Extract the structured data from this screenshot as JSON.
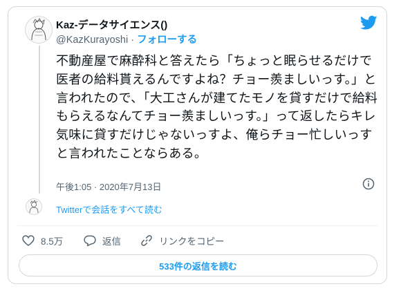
{
  "tweet": {
    "display_name": "Kaz-データサイエンス()",
    "handle": "@KazKurayoshi",
    "separator": " · ",
    "follow_label": "フォローする",
    "text": "不動産屋で麻酔科と答えたら「ちょっと眠らせるだけで医者の給料貰えるんですよね？チョー羨ましいっす。」と言われたので、「大工さんが建てたモノを貸すだけで給料もらえるなんてチョー羨ましいっす。」って返したらキレ気味に貸すだけじゃないっすよ、俺らチョー忙しいっすと言われたことならある。",
    "timestamp": "午後1:05 · 2020年7月13日",
    "thread_link": "Twitterで会話をすべて読む"
  },
  "actions": {
    "likes": "8.5万",
    "reply_label": "返信",
    "copy_link_label": "リンクをコピー"
  },
  "read_replies_label": "533件の返信を読む",
  "colors": {
    "accent": "#1d9bf0",
    "text": "#0f1419",
    "secondary": "#536471",
    "border": "#cfd9de"
  },
  "icons": [
    "twitter-bird-icon",
    "info-icon",
    "heart-icon",
    "reply-icon",
    "link-icon"
  ]
}
